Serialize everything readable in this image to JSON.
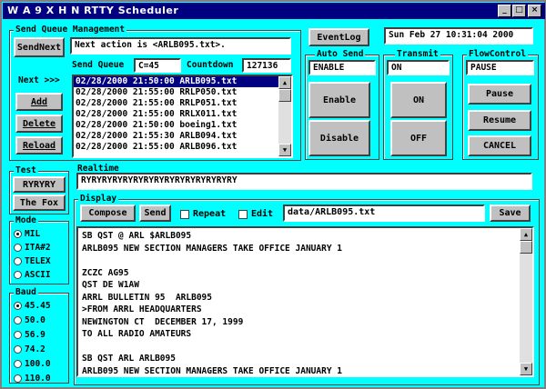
{
  "window": {
    "title": "W A 9 X H N   RTTY Scheduler"
  },
  "titlebar_buttons": {
    "min": "_",
    "max": "□",
    "close": "×"
  },
  "send_queue": {
    "group_label": "Send Queue Management",
    "send_next_label": "SendNext",
    "next_action": "Next action is <ARLB095.txt>.",
    "send_queue_label": "Send Queue",
    "send_queue_value": "C=45",
    "countdown_label": "Countdown",
    "countdown_value": "127136",
    "next_label": "Next >>>",
    "add_label": "Add",
    "delete_label": "Delete",
    "reload_label": "Reload",
    "queue_items": [
      "02/28/2000 21:50:00 ARLB095.txt",
      "02/28/2000 21:55:00 RRLP050.txt",
      "02/28/2000 21:55:00 RRLP051.txt",
      "02/28/2000 21:55:00 RRLX011.txt",
      "02/28/2000 21:50:00 boeing1.txt",
      "02/28/2000 21:55:30 ARLB094.txt",
      "02/28/2000 21:55:00 ARLB096.txt"
    ]
  },
  "eventlog_label": "EventLog",
  "clock": "Sun Feb 27 10:31:04 2000",
  "auto_send": {
    "label": "Auto Send",
    "status": "ENABLE",
    "enable_label": "Enable",
    "disable_label": "Disable"
  },
  "transmit": {
    "label": "Transmit",
    "status": "ON",
    "on_label": "ON",
    "off_label": "OFF"
  },
  "flow_control": {
    "label": "FlowControl",
    "status": "PAUSE",
    "pause_label": "Pause",
    "resume_label": "Resume",
    "cancel_label": "CANCEL"
  },
  "test": {
    "label": "Test",
    "ryryry_label": "RYRYRY",
    "fox_label": "The Fox"
  },
  "realtime": {
    "label": "Realtime",
    "value": "RYRYRYRYRYRYRYRYRYRYRYRYRYRYRY"
  },
  "mode": {
    "label": "Mode",
    "options": [
      "MIL",
      "ITA#2",
      "TELEX",
      "ASCII"
    ],
    "selected": "MIL"
  },
  "baud": {
    "label": "Baud",
    "options": [
      "45.45",
      "50.0",
      "56.9",
      "74.2",
      "100.0",
      "110.0"
    ],
    "selected": "45.45"
  },
  "display": {
    "label": "Display",
    "compose_label": "Compose",
    "send_label": "Send",
    "repeat_label": "Repeat",
    "edit_label": "Edit",
    "file_path": "data/ARLB095.txt",
    "save_label": "Save",
    "lines": [
      "SB QST @ ARL $ARLB095",
      "ARLB095 NEW SECTION MANAGERS TAKE OFFICE JANUARY 1",
      "",
      "ZCZC AG95",
      "QST DE W1AW",
      "ARRL BULLETIN 95  ARLB095",
      ">FROM ARRL HEADQUARTERS",
      "NEWINGTON CT  DECEMBER 17, 1999",
      "TO ALL RADIO AMATEURS",
      "",
      "SB QST ARL ARLB095",
      "ARLB095 NEW SECTION MANAGERS TAKE OFFICE JANUARY 1"
    ]
  }
}
